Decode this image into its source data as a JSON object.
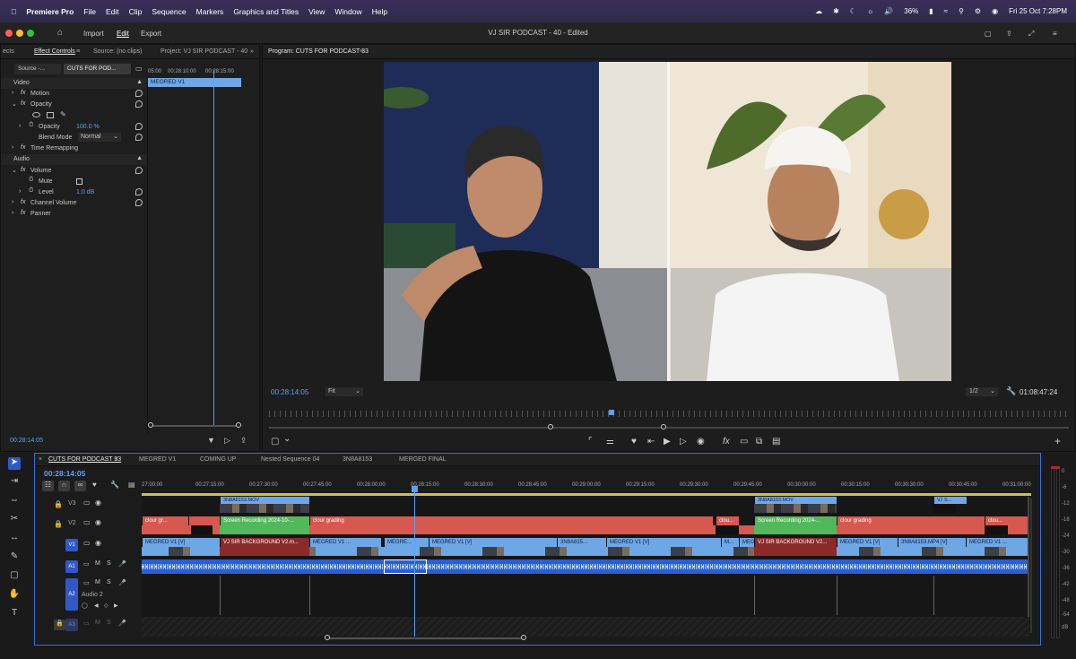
{
  "menubar": {
    "app_name": "Premiere Pro",
    "menus": [
      "File",
      "Edit",
      "Clip",
      "Sequence",
      "Markers",
      "Graphics and Titles",
      "View",
      "Window",
      "Help"
    ],
    "battery": "36%",
    "datetime": "Fri 25 Oct  7:28PM"
  },
  "app": {
    "workspaces": [
      "Import",
      "Edit",
      "Export"
    ],
    "active_workspace": "Edit",
    "document_title": "VJ SIR PODCAST - 40 - Edited"
  },
  "source_panel": {
    "tabs": [
      "ects",
      "Effect Controls",
      "Source: (no clips)",
      "Project: VJ SIR PODCAST - 40"
    ],
    "subtabs": [
      "Source -...",
      "CUTS FOR POD..."
    ],
    "clip_label": "MEGRED V1",
    "ruler_times": [
      "05:00",
      "00:28:10:00",
      "00:28:15:00"
    ],
    "sections": {
      "video": "Video",
      "audio": "Audio"
    },
    "rows": {
      "motion": "Motion",
      "opacity": "Opacity",
      "opacity_param": "Opacity",
      "opacity_value": "100.0 %",
      "blend_mode": "Blend Mode",
      "blend_value": "Normal",
      "time_remapping": "Time Remapping",
      "volume": "Volume",
      "mute": "Mute",
      "level": "Level",
      "level_value": "1.0 dB",
      "channel_volume": "Channel Volume",
      "panner": "Panner"
    },
    "timecode": "00:28:14:05"
  },
  "program_monitor": {
    "title": "Program: CUTS FOR PODCAST 33",
    "timecode": "00:28:14:05",
    "fit": "Fit",
    "resolution": "1/2",
    "duration": "01:08:47:24"
  },
  "timeline": {
    "tabs": [
      "CUTS FOR PODCAST 33",
      "MEGRED V1",
      "COMING UP",
      "Nested Sequence 04",
      "3N8A8153",
      "MERGED FINAL"
    ],
    "timecode": "00:28:14:05",
    "ruler": [
      "27:00:00",
      "00:27:15:00",
      "00:27:30:00",
      "00:27:45:00",
      "00:28:00:00",
      "00:28:15:00",
      "00:28:30:00",
      "00:28:45:00",
      "00:29:00:00",
      "00:29:15:00",
      "00:29:30:00",
      "00:29:45:00",
      "00:30:00:00",
      "00:30:15:00",
      "00:30:30:00",
      "00:30:45:00",
      "00:31:00:00"
    ],
    "tracks": [
      "V3",
      "V2",
      "V1",
      "A1",
      "A2",
      "A3"
    ],
    "a2_name": "Audio 2",
    "track_letters": {
      "m": "M",
      "s": "S"
    },
    "clips": {
      "v3_a": "3N8A8153.MOV",
      "v3_b": "3N8A8153.MOV",
      "v3_c": "VJ S...",
      "v2_a": "clour gr...",
      "v2_b": "Screen Recording 2024-10-...",
      "v2_c": "clour grading",
      "v2_d": "clou...",
      "v2_e": "Screen Recording 2024-...",
      "v2_f": "clour grading",
      "v2_g": "clou...",
      "v1_a": "MEGRED V1 [V]",
      "v1_b": "VJ SIR BACKGROUND V2.m...",
      "v1_c": "MEGRED V1 ...",
      "v1_d": "MEGRE...",
      "v1_e": "MEGRED V1 [V]",
      "v1_f": "3N8A815...",
      "v1_g": "MEGRED V1 [V]",
      "v1_h": "M...",
      "v1_i": "MEGR...",
      "v1_j": "VJ SIR BACKGROUND V2...",
      "v1_k": "MEGRED V1 [V]",
      "v1_l": "3N8A8153.MP4 [V]",
      "v1_m": "MEGRED V1 ..."
    },
    "fx": "fx"
  },
  "meter": {
    "labels": [
      "0",
      "-6",
      "-12",
      "-18",
      "-24",
      "-30",
      "-36",
      "-42",
      "-48",
      "-54",
      "dB"
    ]
  },
  "colors": {
    "accent": "#3a6fd8",
    "clip_blue": "#6ea7e6",
    "clip_red": "#d7584f",
    "clip_green": "#53b85b",
    "playhead": "#5aa0ff"
  }
}
